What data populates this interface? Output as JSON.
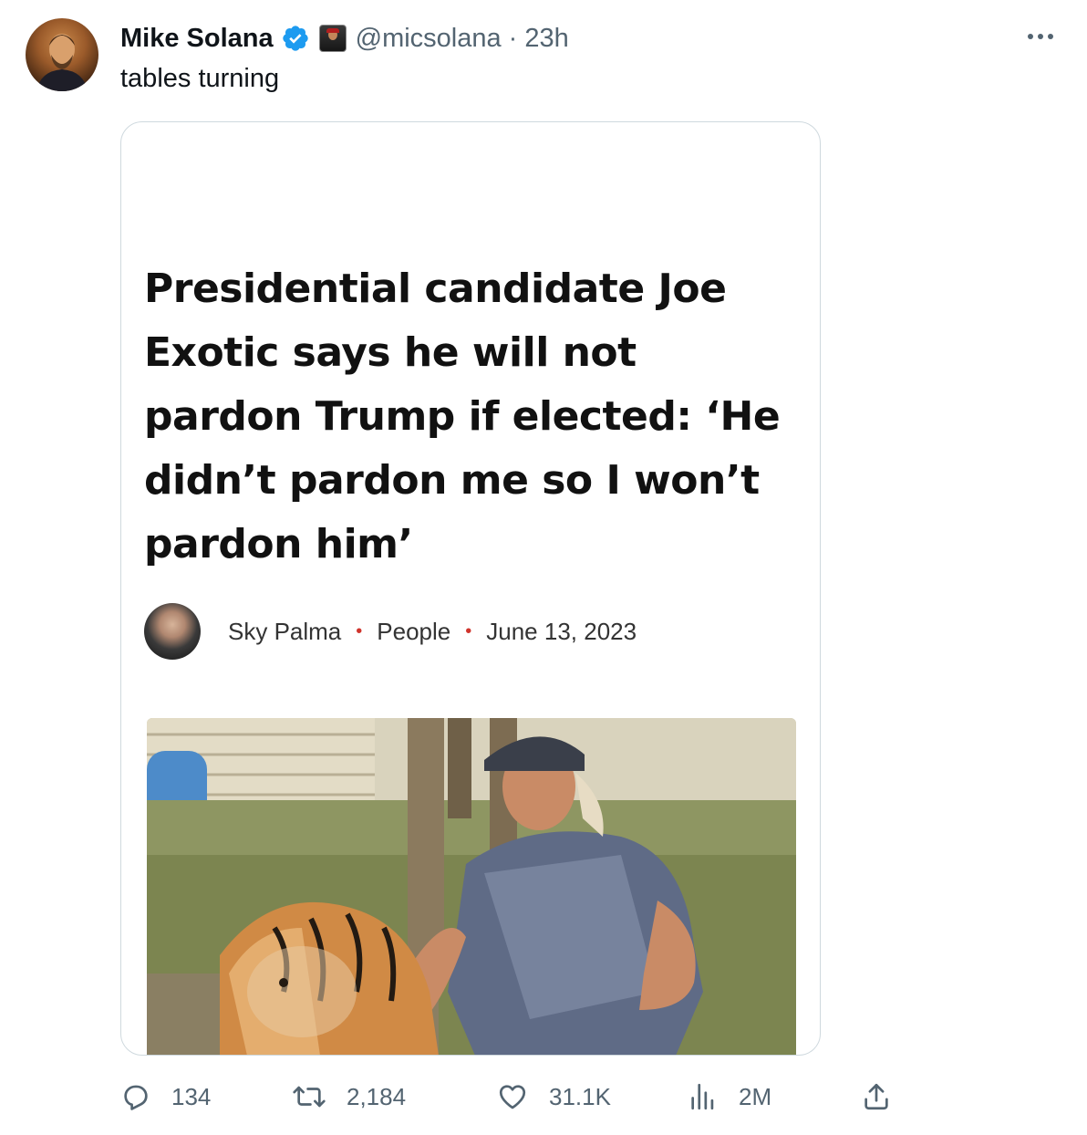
{
  "tweet": {
    "display_name": "Mike Solana",
    "handle": "@micsolana",
    "time": "23h",
    "handle_time": "@micsolana · 23h",
    "text": "tables turning"
  },
  "card": {
    "headline": "Presidential candidate Joe Exotic says he will not pardon Trump if elected: ‘He didn’t pardon me so I won’t pardon him’",
    "author": "Sky Palma",
    "section": "People",
    "date": "June 13, 2023",
    "separator": "•"
  },
  "actions": {
    "replies": "134",
    "retweets": "2,184",
    "likes": "31.1K",
    "views": "2M"
  },
  "colors": {
    "text_primary": "#0f1419",
    "text_secondary": "#536471",
    "verified_blue": "#1d9bf0",
    "card_border": "#cfd9de",
    "byline_dot": "#d0342c"
  },
  "icons": {
    "more": "more-horizontal-icon",
    "verified": "verified-badge-icon",
    "reply": "reply-icon",
    "retweet": "retweet-icon",
    "like": "heart-icon",
    "views": "views-chart-icon",
    "share": "share-icon"
  }
}
